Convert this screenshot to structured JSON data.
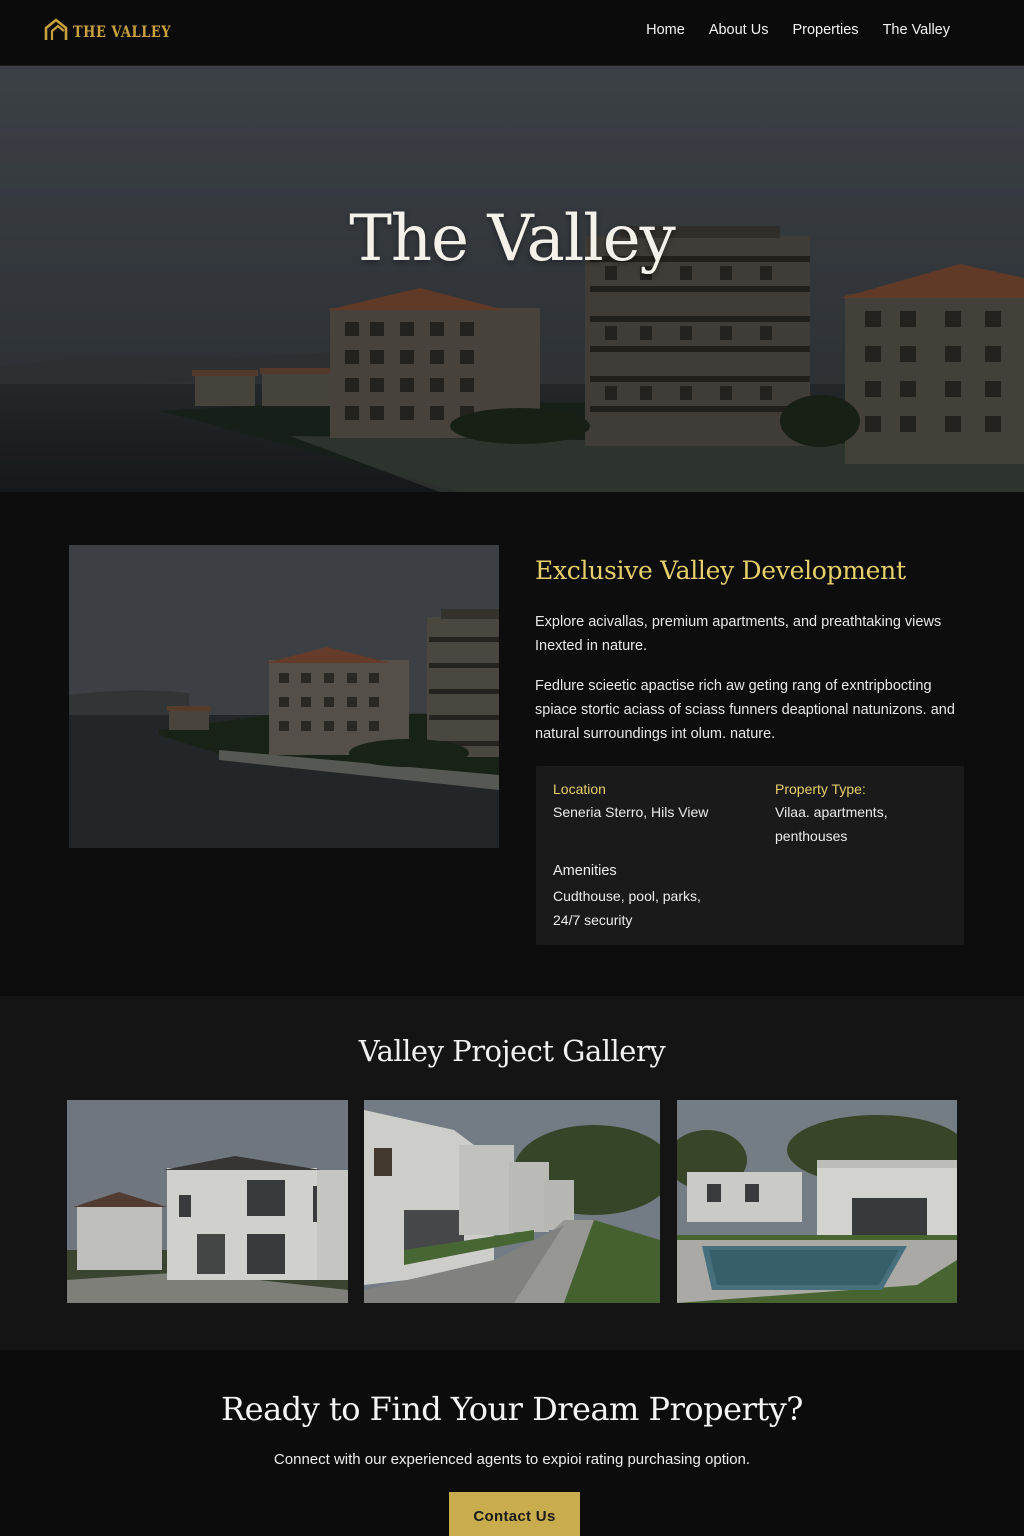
{
  "header": {
    "logo_text": "THE VALLEY",
    "logo_icon": "house-roof-icon",
    "nav": [
      {
        "label": "Home"
      },
      {
        "label": "About Us"
      },
      {
        "label": "Properties"
      },
      {
        "label": "The Valley"
      }
    ]
  },
  "hero": {
    "title": "The Valley"
  },
  "intro": {
    "heading": "Exclusive Valley Development",
    "paragraph_1": "Explore acivallas, premium apartments, and preathtaking views Inexted in nature.",
    "paragraph_2": "Fedlure scieetic apactise rich aw geting rang of exntripbocting spiace stortic aciass of sciass funners deaptional natunizons. and natural surroundings int olum. nature.",
    "details": {
      "location_label": "Location",
      "location_value": "Seneria Sterro, Hils View",
      "type_label": "Property Type:",
      "type_value_1": "Vilaa. apartments,",
      "type_value_2": "penthouses",
      "amenities_label": "Amenities",
      "amenities_value_1": "Cudthouse, pool, parks,",
      "amenities_value_2": "24/7 security"
    }
  },
  "gallery": {
    "title": "Valley Project Gallery"
  },
  "cta": {
    "title": "Ready to Find Your Dream Property?",
    "text": "Connect with our experienced agents to expioi rating purchasing option.",
    "button_label": "Contact Us"
  },
  "colors": {
    "accent_gold": "#e7cf6a",
    "button_gold": "#c9ac4e",
    "background": "#0c0c0c"
  }
}
